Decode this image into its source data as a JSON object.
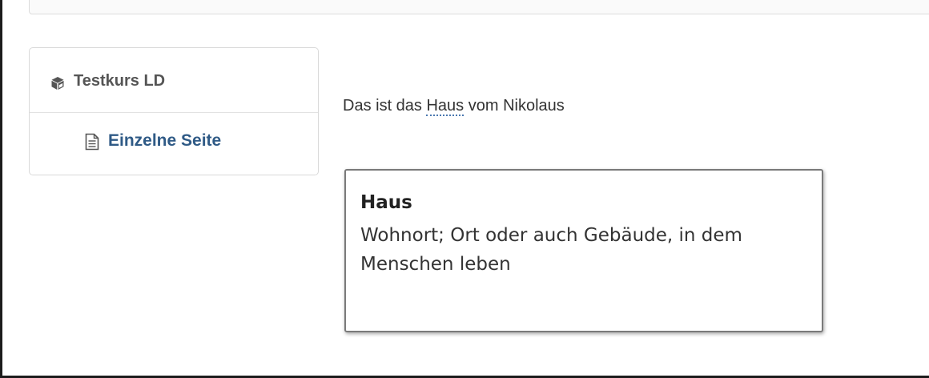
{
  "course": {
    "title": "Testkurs LD",
    "icon": "cube-icon"
  },
  "page_link": {
    "label": "Einzelne Seite",
    "icon": "file-text-icon",
    "color": "#2f5a86"
  },
  "content": {
    "before": "Das ist das ",
    "term": "Haus",
    "after": " vom Nikolaus"
  },
  "tooltip": {
    "title": "Haus",
    "definition": "Wohnort; Ort oder auch Gebäude, in dem Menschen leben"
  }
}
